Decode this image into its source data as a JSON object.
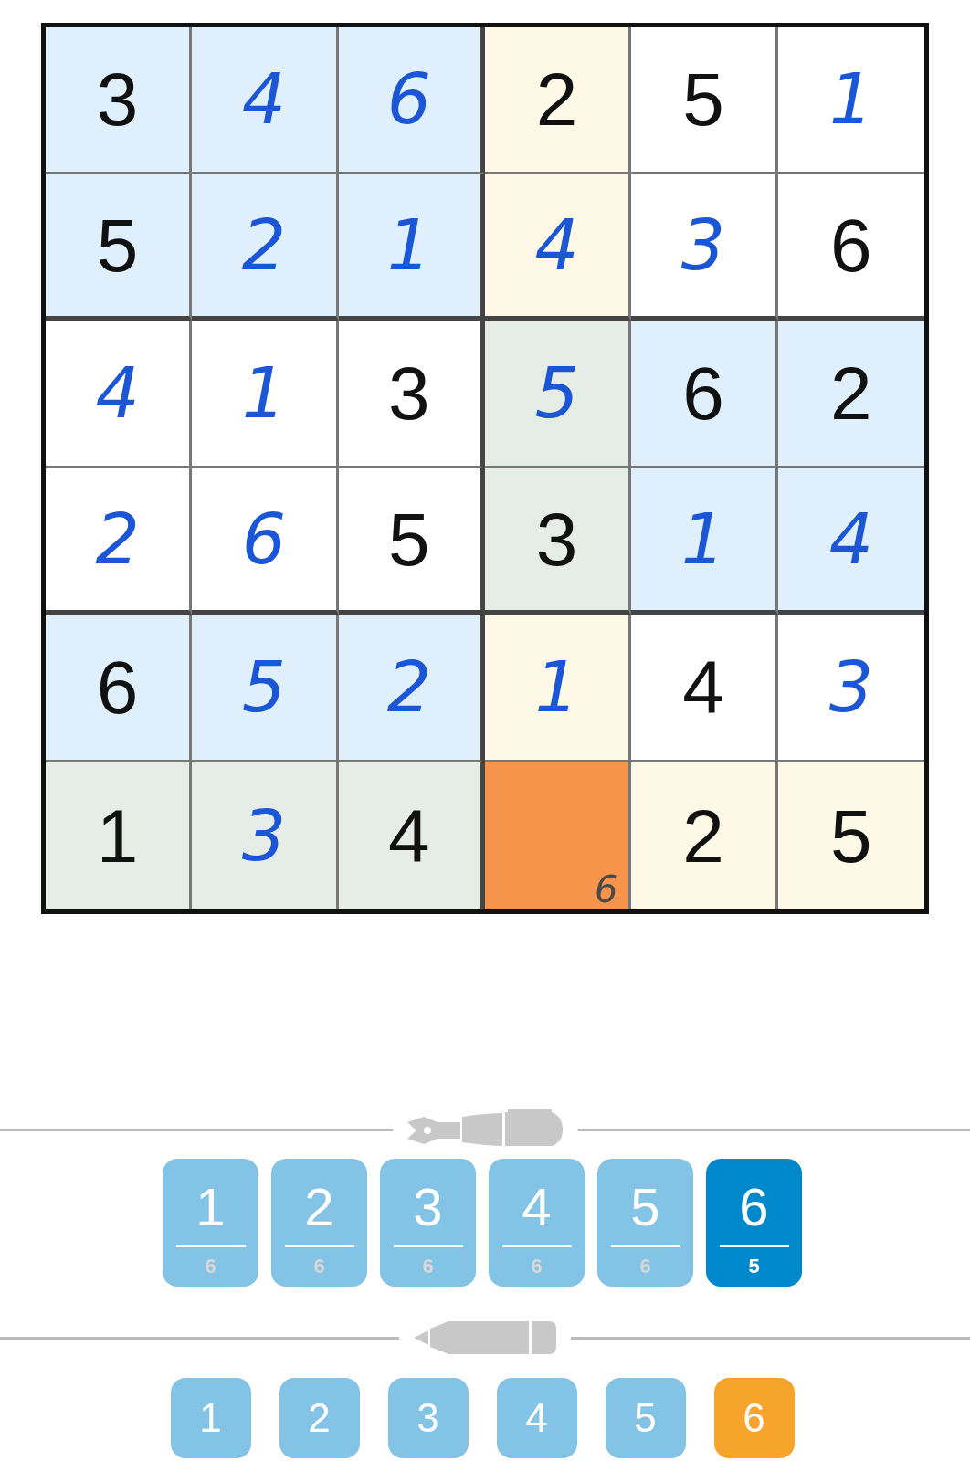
{
  "grid": {
    "rows": [
      {
        "cells": [
          {
            "value": "3",
            "kind": "given",
            "color": "#dff0fc",
            "selected": false
          },
          {
            "value": "4",
            "kind": "entered",
            "color": "#dff0fc",
            "selected": false
          },
          {
            "value": "6",
            "kind": "entered",
            "color": "#dff0fc",
            "selected": false
          },
          {
            "value": "2",
            "kind": "given",
            "color": "#fef8e6",
            "selected": false
          },
          {
            "value": "5",
            "kind": "given",
            "color": "#ffffff",
            "selected": false
          },
          {
            "value": "1",
            "kind": "entered",
            "color": "#ffffff",
            "selected": false
          }
        ]
      },
      {
        "cells": [
          {
            "value": "5",
            "kind": "given",
            "color": "#dff0fc",
            "selected": false
          },
          {
            "value": "2",
            "kind": "entered",
            "color": "#dff0fc",
            "selected": false
          },
          {
            "value": "1",
            "kind": "entered",
            "color": "#dff0fc",
            "selected": false
          },
          {
            "value": "4",
            "kind": "entered",
            "color": "#fef8e6",
            "selected": false
          },
          {
            "value": "3",
            "kind": "entered",
            "color": "#ffffff",
            "selected": false
          },
          {
            "value": "6",
            "kind": "given",
            "color": "#ffffff",
            "selected": false
          }
        ]
      },
      {
        "cells": [
          {
            "value": "4",
            "kind": "entered",
            "color": "#ffffff",
            "selected": false
          },
          {
            "value": "1",
            "kind": "entered",
            "color": "#ffffff",
            "selected": false
          },
          {
            "value": "3",
            "kind": "given",
            "color": "#ffffff",
            "selected": false
          },
          {
            "value": "5",
            "kind": "entered",
            "color": "#e5ede6",
            "selected": false
          },
          {
            "value": "6",
            "kind": "given",
            "color": "#dff0fc",
            "selected": false
          },
          {
            "value": "2",
            "kind": "given",
            "color": "#dff0fc",
            "selected": false
          }
        ]
      },
      {
        "cells": [
          {
            "value": "2",
            "kind": "entered",
            "color": "#ffffff",
            "selected": false
          },
          {
            "value": "6",
            "kind": "entered",
            "color": "#ffffff",
            "selected": false
          },
          {
            "value": "5",
            "kind": "given",
            "color": "#ffffff",
            "selected": false
          },
          {
            "value": "3",
            "kind": "given",
            "color": "#e5ede6",
            "selected": false
          },
          {
            "value": "1",
            "kind": "entered",
            "color": "#dff0fc",
            "selected": false
          },
          {
            "value": "4",
            "kind": "entered",
            "color": "#dff0fc",
            "selected": false
          }
        ]
      },
      {
        "cells": [
          {
            "value": "6",
            "kind": "given",
            "color": "#dff0fc",
            "selected": false
          },
          {
            "value": "5",
            "kind": "entered",
            "color": "#dff0fc",
            "selected": false
          },
          {
            "value": "2",
            "kind": "entered",
            "color": "#dff0fc",
            "selected": false
          },
          {
            "value": "1",
            "kind": "entered",
            "color": "#fef8e6",
            "selected": false
          },
          {
            "value": "4",
            "kind": "given",
            "color": "#ffffff",
            "selected": false
          },
          {
            "value": "3",
            "kind": "entered",
            "color": "#ffffff",
            "selected": false
          }
        ]
      },
      {
        "cells": [
          {
            "value": "1",
            "kind": "given",
            "color": "#e5ede6",
            "selected": false
          },
          {
            "value": "3",
            "kind": "entered",
            "color": "#e5ede6",
            "selected": false
          },
          {
            "value": "4",
            "kind": "given",
            "color": "#e5ede6",
            "selected": false
          },
          {
            "kind": "entered",
            "selected": true,
            "notes": [
              "6"
            ]
          },
          {
            "value": "2",
            "kind": "given",
            "color": "#fef8e6",
            "selected": false
          },
          {
            "value": "5",
            "kind": "given",
            "color": "#fef8e6",
            "selected": false
          }
        ]
      }
    ]
  },
  "pen_buttons": [
    {
      "digit": "1",
      "count": "6",
      "selected": false
    },
    {
      "digit": "2",
      "count": "6",
      "selected": false
    },
    {
      "digit": "3",
      "count": "6",
      "selected": false
    },
    {
      "digit": "4",
      "count": "6",
      "selected": false
    },
    {
      "digit": "5",
      "count": "6",
      "selected": false
    },
    {
      "digit": "6",
      "count": "5",
      "selected": true
    }
  ],
  "pencil_buttons": [
    {
      "digit": "1",
      "selected": false
    },
    {
      "digit": "2",
      "selected": false
    },
    {
      "digit": "3",
      "selected": false
    },
    {
      "digit": "4",
      "selected": false
    },
    {
      "digit": "5",
      "selected": false
    },
    {
      "digit": "6",
      "selected": true
    }
  ]
}
